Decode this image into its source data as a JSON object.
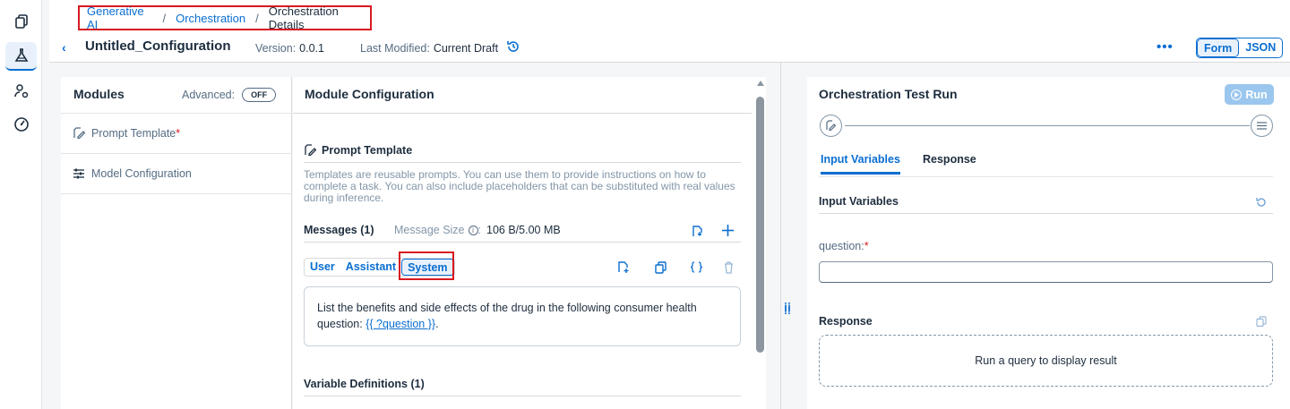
{
  "colors": {
    "accent": "#0a6ed1",
    "highlight_box": "#d71920",
    "text": "#1d2d3e",
    "muted": "#556b82"
  },
  "rail": {
    "items": [
      "documents-icon",
      "flask-icon",
      "user-settings-icon",
      "gauge-icon"
    ],
    "active_index": 1
  },
  "header": {
    "breadcrumb": [
      "Generative AI",
      "Orchestration",
      "Orchestration Details"
    ],
    "title": "Untitled_Configuration",
    "version_label": "Version:",
    "version_value": "0.0.1",
    "modified_label": "Last Modified:",
    "modified_value": "Current Draft",
    "more_label": "•••",
    "view_toggle": [
      "Form",
      "JSON"
    ],
    "view_selected": "Form"
  },
  "modules": {
    "title": "Modules",
    "advanced_label": "Advanced:",
    "advanced_toggle": "OFF",
    "items": [
      {
        "label": "Prompt Template",
        "required": "*"
      },
      {
        "label": "Model Configuration"
      }
    ]
  },
  "config": {
    "title": "Module Configuration",
    "section_title": "Prompt Template",
    "description": "Templates are reusable prompts. You can use them to provide instructions on how to complete a task. You can also include placeholders that can be substituted with real values during inference.",
    "messages_label": "Messages (1)",
    "message_size_label": "Message Size",
    "message_size_value": "106 B/5.00 MB",
    "roles": [
      "User",
      "Assistant",
      "System"
    ],
    "role_selected": "System",
    "message_text": "List the benefits and side effects of the drug in the following consumer health question: ",
    "message_variable": "{{ ?question }}",
    "message_suffix": ".",
    "variable_definitions": "Variable Definitions (1)"
  },
  "test_run": {
    "title": "Orchestration Test Run",
    "run_label": "Run",
    "tabs": [
      "Input Variables",
      "Response"
    ],
    "active_tab": "Input Variables",
    "input_variables_title": "Input Variables",
    "question_label": "question:",
    "question_required": "*",
    "question_value": "",
    "response_title": "Response",
    "response_placeholder": "Run a query to display result"
  }
}
